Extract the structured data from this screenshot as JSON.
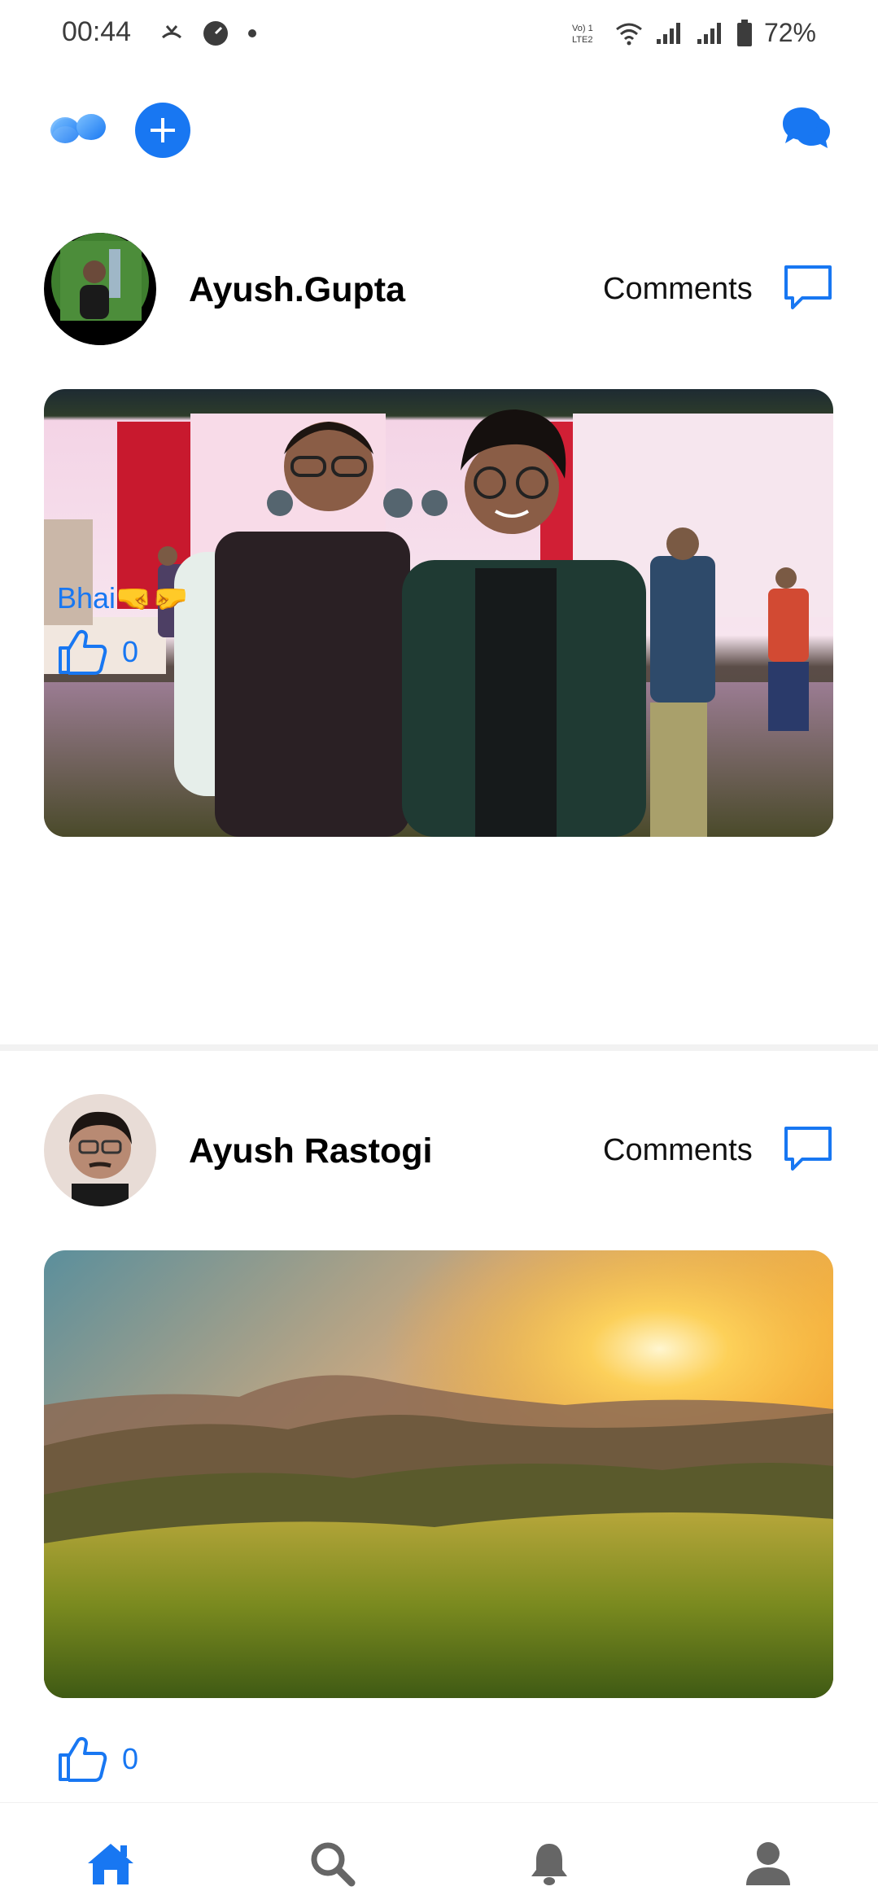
{
  "status_bar": {
    "time": "00:44",
    "left_icons": [
      "missed-call-icon",
      "speedometer-icon",
      "dot-icon"
    ],
    "right_icons": [
      "volte-icon",
      "wifi-icon",
      "signal-icon",
      "signal-icon",
      "battery-icon"
    ],
    "volte_label": "Vo) LTE2",
    "battery": "72%"
  },
  "header": {
    "logo_icon": "app-logo-icon",
    "add_icon": "plus-icon",
    "messages_icon": "messenger-chat-icon"
  },
  "posts": [
    {
      "username": "Ayush.Gupta",
      "comments_label": "Comments",
      "image": "photo-two-friends-at-event",
      "caption": "Bhai🤜🤛",
      "likes": "0"
    },
    {
      "username": "Ayush Rastogi",
      "comments_label": "Comments",
      "image": "photo-sunset-over-mountains",
      "caption": "",
      "likes": "0"
    }
  ],
  "bottom_nav": {
    "items": [
      {
        "name": "home",
        "icon": "home-icon",
        "active": true
      },
      {
        "name": "search",
        "icon": "search-icon",
        "active": false
      },
      {
        "name": "notifications",
        "icon": "bell-icon",
        "active": false
      },
      {
        "name": "profile",
        "icon": "profile-icon",
        "active": false
      }
    ]
  },
  "colors": {
    "accent": "#1877f2",
    "inactive_icon": "#666666"
  }
}
